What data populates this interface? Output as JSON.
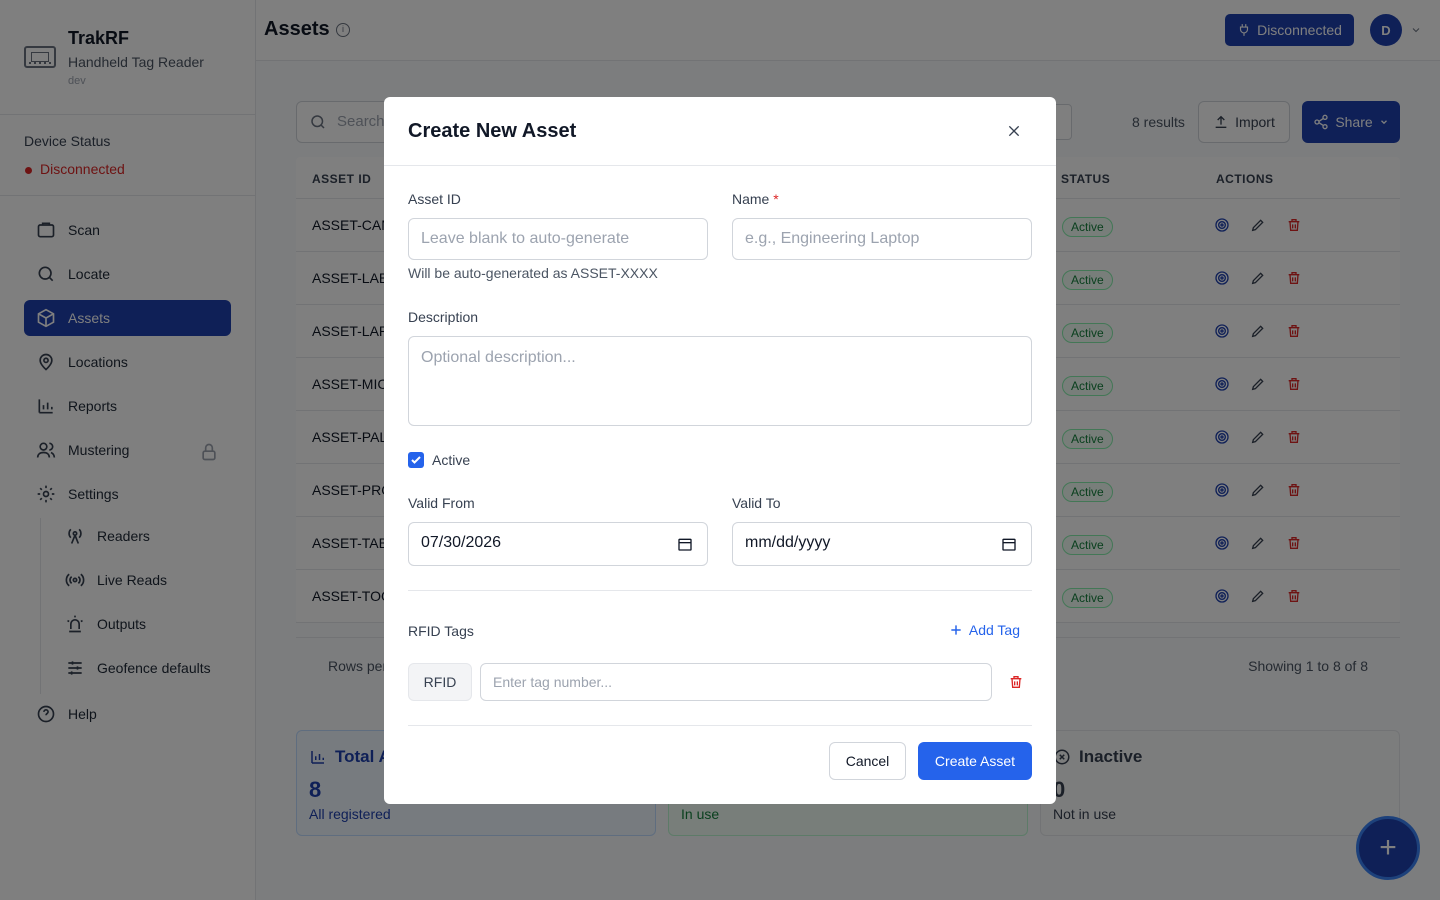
{
  "app": {
    "title": "TrakRF",
    "subtitle": "Handheld Tag Reader",
    "env": "dev"
  },
  "device": {
    "label": "Device Status",
    "status": "Disconnected"
  },
  "nav": {
    "scan": "Scan",
    "locate": "Locate",
    "assets": "Assets",
    "locations": "Locations",
    "reports": "Reports",
    "mustering": "Mustering",
    "settings": "Settings",
    "help": "Help"
  },
  "subnav": {
    "readers": "Readers",
    "live_reads": "Live Reads",
    "outputs": "Outputs",
    "geofence": "Geofence defaults"
  },
  "header": {
    "title": "Assets",
    "connection": "Disconnected",
    "avatar": "D"
  },
  "toolbar": {
    "search_placeholder": "Search",
    "results": "8 results",
    "import": "Import",
    "share": "Share"
  },
  "table": {
    "headers": {
      "asset_id": "ASSET ID",
      "status": "STATUS",
      "actions": "ACTIONS"
    },
    "rows": [
      {
        "id": "ASSET-CAM",
        "status": "Active"
      },
      {
        "id": "ASSET-LAB",
        "status": "Active"
      },
      {
        "id": "ASSET-LAPT",
        "status": "Active"
      },
      {
        "id": "ASSET-MICI",
        "status": "Active"
      },
      {
        "id": "ASSET-PALI",
        "status": "Active"
      },
      {
        "id": "ASSET-PRO",
        "status": "Active"
      },
      {
        "id": "ASSET-TABI",
        "status": "Active"
      },
      {
        "id": "ASSET-TOO",
        "status": "Active"
      }
    ],
    "rows_per": "Rows per",
    "showing": "Showing 1 to 8 of 8"
  },
  "cards": {
    "total": {
      "title": "Total A",
      "value": "8",
      "sub": "All registered"
    },
    "active": {
      "sub": "In use"
    },
    "inactive": {
      "title": "Inactive",
      "value": "0",
      "sub": "Not in use"
    }
  },
  "modal": {
    "title": "Create New Asset",
    "asset_id_label": "Asset ID",
    "asset_id_placeholder": "Leave blank to auto-generate",
    "asset_id_hint": "Will be auto-generated as ASSET-XXXX",
    "name_label": "Name",
    "name_required": "*",
    "name_placeholder": "e.g., Engineering Laptop",
    "description_label": "Description",
    "description_placeholder": "Optional description...",
    "active_label": "Active",
    "valid_from_label": "Valid From",
    "valid_from_value": "07/30/2026",
    "valid_to_label": "Valid To",
    "valid_to_value": "mm/dd/yyyy",
    "rfid_label": "RFID Tags",
    "add_tag": "Add Tag",
    "rfid_chip": "RFID",
    "tag_placeholder": "Enter tag number...",
    "cancel": "Cancel",
    "create": "Create Asset"
  },
  "colors": {
    "primary": "#1e40af",
    "accent": "#2563eb",
    "danger": "#dc2626",
    "success": "#15803d"
  }
}
